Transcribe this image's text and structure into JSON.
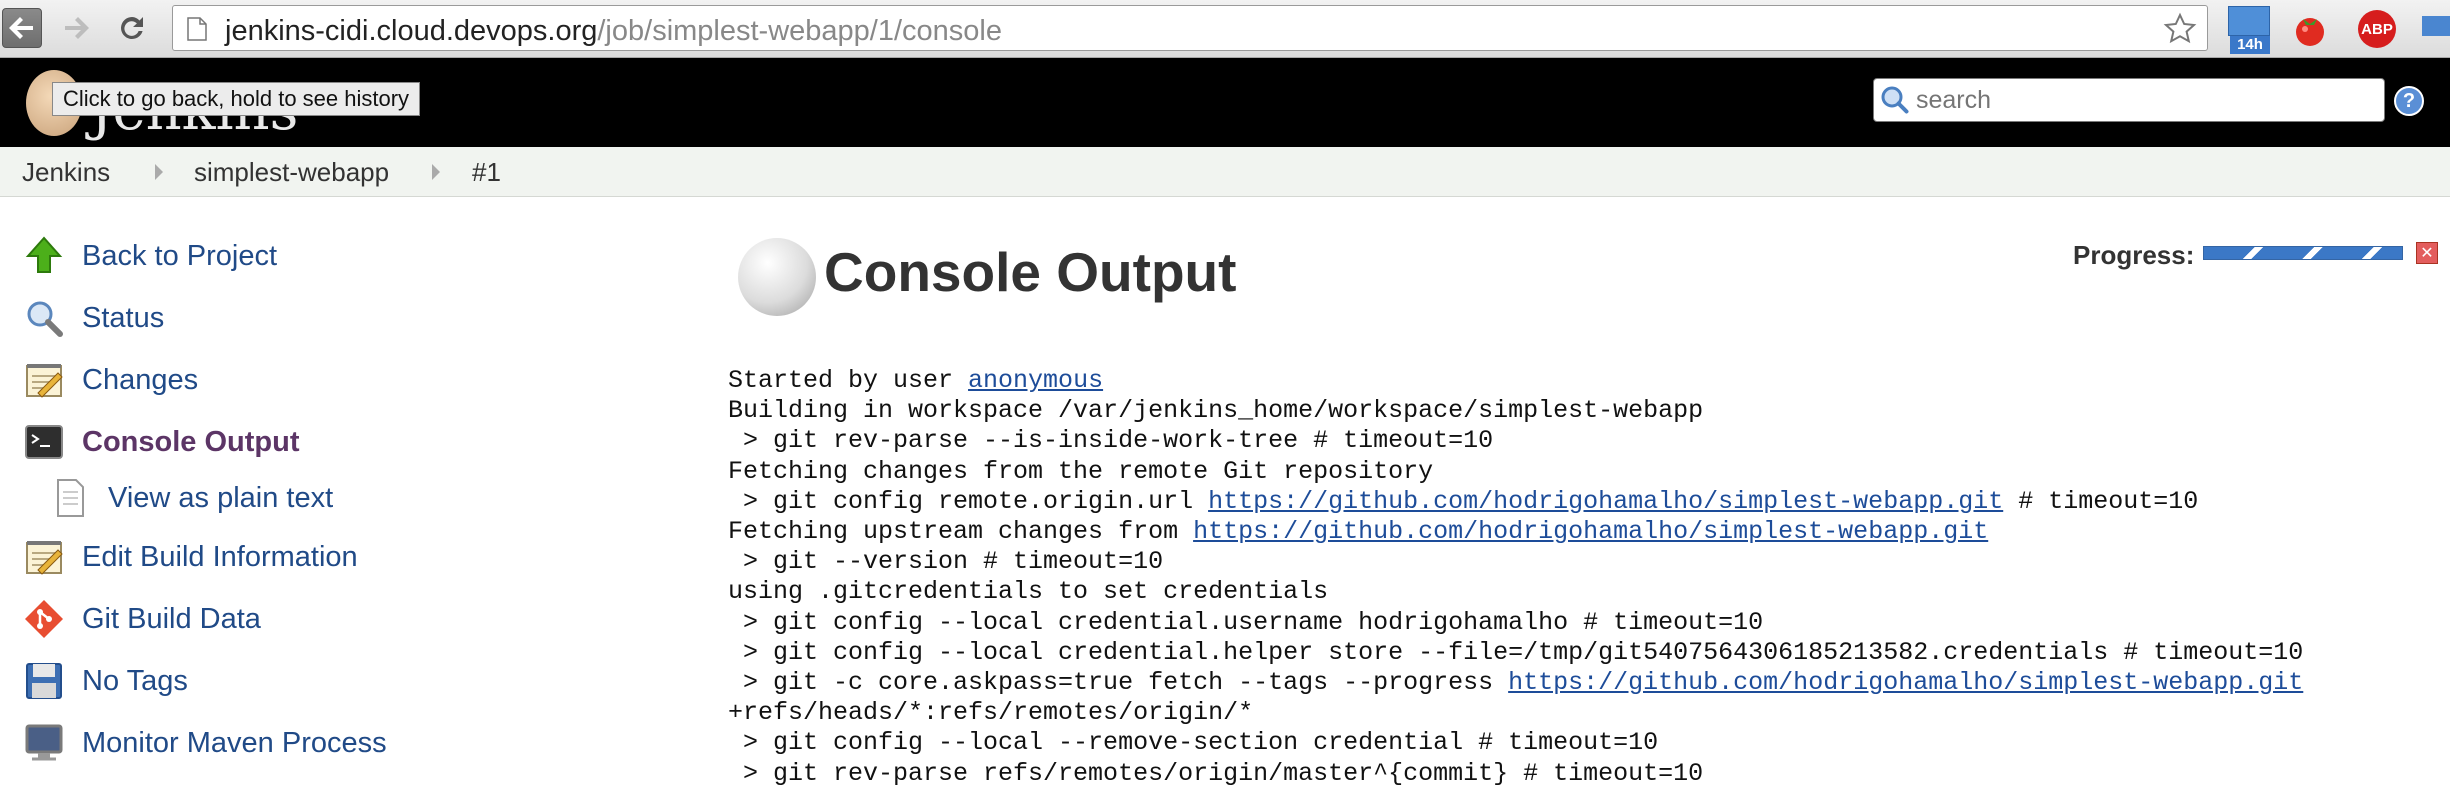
{
  "browser": {
    "url_host": "jenkins-cidi.cloud.devops.org",
    "url_path": "/job/simplest-webapp/1/console",
    "calendar_badge": "14h",
    "abp_label": "ABP"
  },
  "header": {
    "logo_text": "Jenkins",
    "tooltip": "Click to go back, hold to see history",
    "search_placeholder": "search",
    "help": "?"
  },
  "breadcrumb": [
    "Jenkins",
    "simplest-webapp",
    "#1"
  ],
  "sidebar": {
    "items": [
      {
        "label": "Back to Project",
        "icon": "up-arrow-icon"
      },
      {
        "label": "Status",
        "icon": "magnifier-icon"
      },
      {
        "label": "Changes",
        "icon": "notepad-icon"
      },
      {
        "label": "Console Output",
        "icon": "terminal-icon",
        "active": true
      },
      {
        "label": "View as plain text",
        "icon": "document-icon"
      },
      {
        "label": "Edit Build Information",
        "icon": "notepad-icon"
      },
      {
        "label": "Git Build Data",
        "icon": "git-icon"
      },
      {
        "label": "No Tags",
        "icon": "floppy-icon"
      },
      {
        "label": "Monitor Maven Process",
        "icon": "monitor-icon"
      }
    ]
  },
  "main": {
    "title": "Console Output",
    "progress_label": "Progress:",
    "console": [
      {
        "text": "Started by user ",
        "link": "anonymous",
        "after": ""
      },
      {
        "text": "Building in workspace /var/jenkins_home/workspace/simplest-webapp"
      },
      {
        "text": " > git rev-parse --is-inside-work-tree # timeout=10"
      },
      {
        "text": "Fetching changes from the remote Git repository"
      },
      {
        "text": " > git config remote.origin.url ",
        "link": "https://github.com/hodrigohamalho/simplest-webapp.git",
        "after": " # timeout=10"
      },
      {
        "text": "Fetching upstream changes from ",
        "link": "https://github.com/hodrigohamalho/simplest-webapp.git",
        "after": ""
      },
      {
        "text": " > git --version # timeout=10"
      },
      {
        "text": "using .gitcredentials to set credentials"
      },
      {
        "text": " > git config --local credential.username hodrigohamalho # timeout=10"
      },
      {
        "text": " > git config --local credential.helper store --file=/tmp/git5407564306185213582.credentials # timeout=10"
      },
      {
        "text": " > git -c core.askpass=true fetch --tags --progress ",
        "link": "https://github.com/hodrigohamalho/simplest-webapp.git",
        "after": ""
      },
      {
        "text": "+refs/heads/*:refs/remotes/origin/*"
      },
      {
        "text": " > git config --local --remove-section credential # timeout=10"
      },
      {
        "text": " > git rev-parse refs/remotes/origin/master^{commit} # timeout=10"
      }
    ]
  }
}
